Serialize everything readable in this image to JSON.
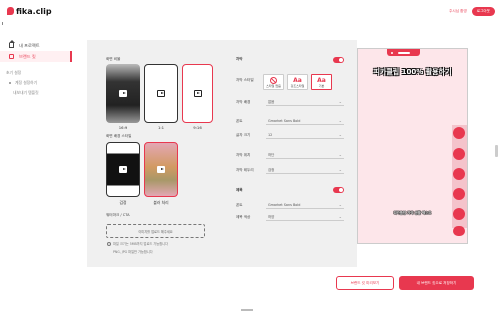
{
  "app": {
    "logo": "fika.clip",
    "user": "주시님 환영",
    "login": "로그아웃"
  },
  "sidebar": {
    "items": [
      {
        "label": "내 프로젝트",
        "icon": "home-icon"
      },
      {
        "label": "브랜드 킷",
        "icon": "brand-kit-icon"
      }
    ],
    "section": "초기 설정",
    "sub": [
      {
        "label": "계정 설정하기"
      },
      {
        "label": "내보내기 템플릿"
      }
    ]
  },
  "format": {
    "title": "화면 비율",
    "ratios": [
      "16:9",
      "1:1",
      "9:16"
    ],
    "bg_title": "화면 배경 스타일",
    "bgs": [
      "검정",
      "블러 처리"
    ],
    "cta_title": "워터마크 / CTA",
    "cta_box": "이미지를 업로드 해주세요",
    "note1": "파일 크기는 5MB까지 업로드 가능합니다",
    "note2": "PNG, JPG 파일만 가능합니다"
  },
  "subtitle": {
    "title": "자막",
    "style_label": "자막 스타일",
    "options": [
      {
        "glyph": "",
        "label": "스타일 없음",
        "icon": "none-icon"
      },
      {
        "glyph": "Aa",
        "label": "강조스타일"
      },
      {
        "glyph": "Aa",
        "label": "기본"
      }
    ],
    "rows": [
      {
        "label": "자막 배경",
        "value": "없음"
      },
      {
        "label": "폰트",
        "value": "Gmarket Sans Bold"
      },
      {
        "label": "글자 크기",
        "value": "12"
      },
      {
        "label": "자막 위치",
        "value": "하단"
      },
      {
        "label": "자막 테두리",
        "value": "검정"
      }
    ]
  },
  "title_section": {
    "title": "제목",
    "rows": [
      {
        "label": "폰트",
        "value": "Gmarket Sans Bold"
      },
      {
        "label": "제목 색상",
        "value": "하양"
      }
    ]
  },
  "preview": {
    "title": "피카클립 100% 활용하기",
    "sub": "피카클립 자막 샘플 텍스트"
  },
  "actions": {
    "save_draft": "브랜드 킷 미리보기",
    "save": "내 브랜드 킷으로 저장하기"
  },
  "colors": {
    "accent": "#e8384f",
    "panel": "#f0f0f0",
    "preview_bg": "#fde6ea"
  }
}
